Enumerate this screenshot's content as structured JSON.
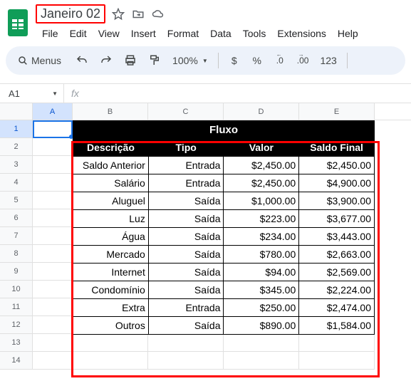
{
  "doc_title": "Janeiro 02",
  "menus": [
    "File",
    "Edit",
    "View",
    "Insert",
    "Format",
    "Data",
    "Tools",
    "Extensions",
    "Help"
  ],
  "toolbar": {
    "menus_label": "Menus",
    "zoom": "100%",
    "currency": "$",
    "percent": "%",
    "dec_dec": ".0",
    "inc_dec": ".00",
    "numfmt": "123"
  },
  "namebox": "A1",
  "columns": [
    "A",
    "B",
    "C",
    "D",
    "E"
  ],
  "row_count": 14,
  "chart_data": {
    "type": "table",
    "title": "Fluxo",
    "headers": [
      "Descrição",
      "Tipo",
      "Valor",
      "Saldo Final"
    ],
    "rows": [
      {
        "desc": "Saldo Anterior",
        "tipo": "Entrada",
        "valor": "$2,450.00",
        "saldo": "$2,450.00"
      },
      {
        "desc": "Salário",
        "tipo": "Entrada",
        "valor": "$2,450.00",
        "saldo": "$4,900.00"
      },
      {
        "desc": "Aluguel",
        "tipo": "Saída",
        "valor": "$1,000.00",
        "saldo": "$3,900.00"
      },
      {
        "desc": "Luz",
        "tipo": "Saída",
        "valor": "$223.00",
        "saldo": "$3,677.00"
      },
      {
        "desc": "Água",
        "tipo": "Saída",
        "valor": "$234.00",
        "saldo": "$3,443.00"
      },
      {
        "desc": "Mercado",
        "tipo": "Saída",
        "valor": "$780.00",
        "saldo": "$2,663.00"
      },
      {
        "desc": "Internet",
        "tipo": "Saída",
        "valor": "$94.00",
        "saldo": "$2,569.00"
      },
      {
        "desc": "Condomínio",
        "tipo": "Saída",
        "valor": "$345.00",
        "saldo": "$2,224.00"
      },
      {
        "desc": "Extra",
        "tipo": "Entrada",
        "valor": "$250.00",
        "saldo": "$2,474.00"
      },
      {
        "desc": "Outros",
        "tipo": "Saída",
        "valor": "$890.00",
        "saldo": "$1,584.00"
      }
    ]
  }
}
